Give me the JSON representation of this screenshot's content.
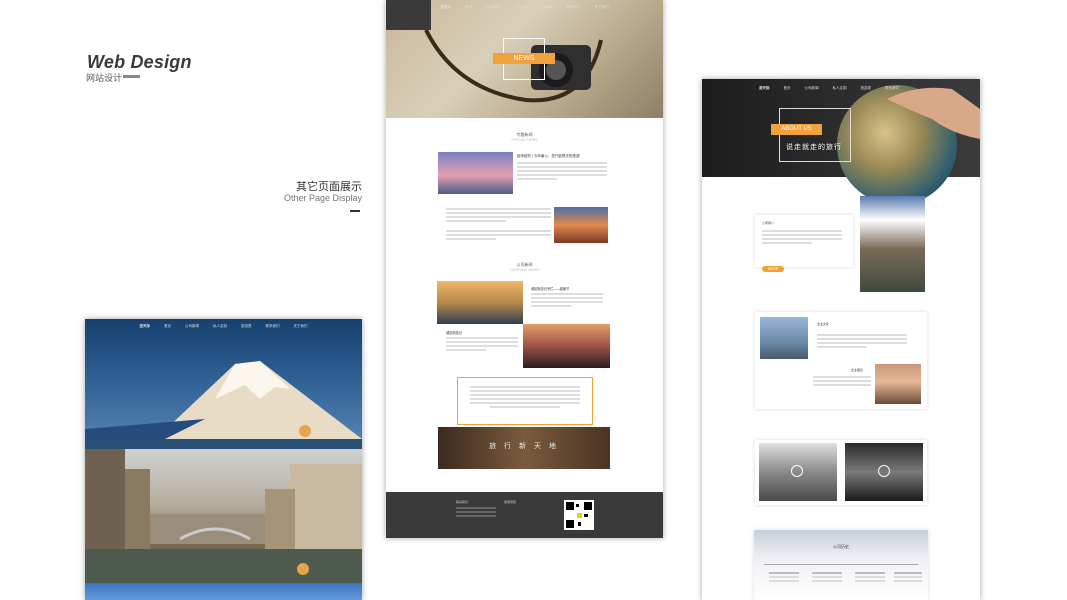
{
  "header": {
    "title": "Web Design",
    "subtitle": "网站设计"
  },
  "section": {
    "title": "其它页面展示",
    "subtitle": "Other Page Display"
  },
  "left_page": {
    "logo": "游天际",
    "nav": [
      "首页",
      "公司新闻",
      "私人定制",
      "旅游类",
      "联系我们",
      "关于我们"
    ]
  },
  "center_page": {
    "logo": "游天际",
    "nav": [
      "首页",
      "公司新闻",
      "私人定制",
      "旅游类",
      "联系我们",
      "关于我们"
    ],
    "hero_tag": "NEWS",
    "special_news": {
      "title": "专题新闻",
      "subtitle": "SPECIAL NEWS",
      "headline": "越来越热 | 今年最火，您只能想去的旅游!"
    },
    "company_news": {
      "title": "公司新闻",
      "subtitle": "COMPANY NEWS",
      "item1": "威尼斯游记专栏——越南节",
      "item2": "威尼斯游记"
    },
    "banner": "旅 行 新 天 地",
    "footer": {
      "col1": "联系我们",
      "col2": "旅游须知"
    }
  },
  "right_page": {
    "logo": "游天际",
    "nav": [
      "首页",
      "公司新闻",
      "私人定制",
      "旅游类",
      "联系我们"
    ],
    "hero_tag": "ABOUT US",
    "hero_sub": "说走就走的旅行",
    "intro": {
      "title": "公司简介",
      "more": "MORE"
    },
    "culture": {
      "title": "企业文化"
    },
    "idea": {
      "title": "企业理念"
    },
    "history": {
      "title": "公司历史"
    }
  }
}
